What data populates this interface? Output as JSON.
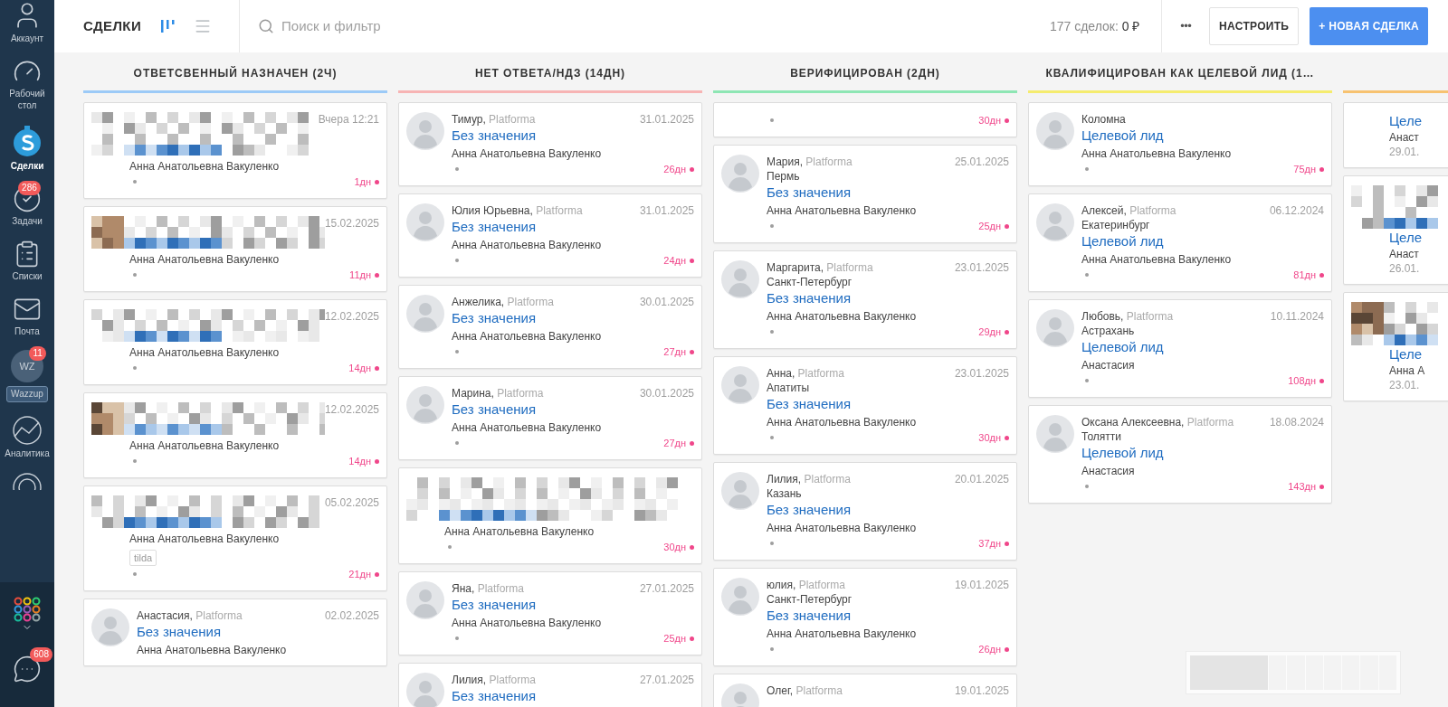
{
  "sidebar": {
    "items": [
      {
        "label": "Аккаунт",
        "selected": false
      },
      {
        "label": "Рабочий стол",
        "selected": false
      },
      {
        "label": "Сделки",
        "selected": true
      },
      {
        "label": "Задачи",
        "selected": false,
        "badge": "286"
      },
      {
        "label": "Списки",
        "selected": false
      },
      {
        "label": "Почта",
        "selected": false
      },
      {
        "label": "Wazzup",
        "selected": false,
        "avatar": "WZ",
        "badge": "11"
      },
      {
        "label": "Аналитика",
        "selected": false
      },
      {
        "selected": false
      }
    ],
    "bottom": [
      {
        "kind": "apps"
      },
      {
        "kind": "chat",
        "badge": "608"
      }
    ]
  },
  "header": {
    "title": "СДЕЛКИ",
    "views": [
      {
        "kind": "pipeline",
        "selected": true
      },
      {
        "kind": "list",
        "selected": false
      }
    ],
    "search": {
      "placeholder": "Поиск и фильтр"
    },
    "count": "177 сделок:",
    "sum": "0 ₽",
    "more": "•••",
    "buttons": [
      {
        "label": "НАСТРОИТЬ",
        "kind": "secondary"
      },
      {
        "label": "+ НОВАЯ СДЕЛКА",
        "kind": "primary"
      }
    ]
  },
  "columns": [
    {
      "title": "ОТВЕТСВЕННЫЙ НАЗНАЧЕН (2Ч)",
      "color": "#9ccaf7",
      "cards": [
        {
          "kind": "blurred",
          "date": "Вчера 12:21",
          "manager": "Анна Анатольевна Вакуленко",
          "days": "1дн"
        },
        {
          "kind": "blurred",
          "date": "15.02.2025",
          "manager": "Анна Анатольевна Вакуленко",
          "days": "11дн"
        },
        {
          "kind": "blurred",
          "date": "12.02.2025",
          "manager": "Анна Анатольевна Вакуленко",
          "days": "14дн"
        },
        {
          "kind": "blurred",
          "date": "12.02.2025",
          "manager": "Анна Анатольевна Вакуленко",
          "days": "14дн"
        },
        {
          "kind": "blurred",
          "date": "05.02.2025",
          "manager": "Анна Анатольевна Вакуленко",
          "tag": "tilda",
          "days": "21дн"
        },
        {
          "kind": "contact",
          "name": "Анастасия,",
          "source": "Platforma",
          "date": "02.02.2025",
          "title": "Без значения",
          "manager": "Анна Анатольевна Вакуленко"
        }
      ]
    },
    {
      "title": "НЕТ ОТВЕТА/НДЗ (14ДН)",
      "color": "#f7b4b4",
      "cards": [
        {
          "kind": "contact",
          "name": "Тимур,",
          "source": "Platforma",
          "date": "31.01.2025",
          "title": "Без значения",
          "manager": "Анна Анатольевна Вакуленко",
          "days": "26дн"
        },
        {
          "kind": "contact",
          "name": "Юлия Юрьевна,",
          "source": "Platforma",
          "date": "31.01.2025",
          "title": "Без значения",
          "manager": "Анна Анатольевна Вакуленко",
          "days": "24дн"
        },
        {
          "kind": "contact",
          "name": "Анжелика,",
          "source": "Platforma",
          "date": "30.01.2025",
          "title": "Без значения",
          "manager": "Анна Анатольевна Вакуленко",
          "days": "27дн"
        },
        {
          "kind": "contact",
          "name": "Марина,",
          "source": "Platforma",
          "date": "30.01.2025",
          "title": "Без значения",
          "manager": "Анна Анатольевна Вакуленко",
          "days": "27дн"
        },
        {
          "kind": "blurred",
          "manager": "Анна Анатольевна Вакуленко",
          "days": "30дн"
        },
        {
          "kind": "contact",
          "name": "Яна,",
          "source": "Platforma",
          "date": "27.01.2025",
          "title": "Без значения",
          "manager": "Анна Анатольевна Вакуленко",
          "days": "25дн"
        },
        {
          "kind": "contact",
          "name": "Лилия,",
          "source": "Platforma",
          "date": "27.01.2025",
          "title": "Без значения"
        }
      ]
    },
    {
      "title": "ВЕРИФИЦИРОВАН (2ДН)",
      "color": "#8ee6b4",
      "cards": [
        {
          "kind": "contact",
          "days": "30дн"
        },
        {
          "kind": "contact",
          "name": "Мария,",
          "source": "Platforma",
          "date": "25.01.2025",
          "city": "Пермь",
          "title": "Без значения",
          "manager": "Анна Анатольевна Вакуленко",
          "days": "25дн"
        },
        {
          "kind": "contact",
          "name": "Маргарита,",
          "source": "Platforma",
          "date": "23.01.2025",
          "city": "Санкт-Петербург",
          "title": "Без значения",
          "manager": "Анна Анатольевна Вакуленко",
          "days": "29дн"
        },
        {
          "kind": "contact",
          "name": "Анна,",
          "source": "Platforma",
          "date": "23.01.2025",
          "city": "Апатиты",
          "title": "Без значения",
          "manager": "Анна Анатольевна Вакуленко",
          "days": "30дн"
        },
        {
          "kind": "contact",
          "name": "Лилия,",
          "source": "Platforma",
          "date": "20.01.2025",
          "city": "Казань",
          "title": "Без значения",
          "manager": "Анна Анатольевна Вакуленко",
          "days": "37дн"
        },
        {
          "kind": "contact",
          "name": "юлия,",
          "source": "Platforma",
          "date": "19.01.2025",
          "city": "Санкт-Петербург",
          "title": "Без значения",
          "manager": "Анна Анатольевна Вакуленко",
          "days": "26дн"
        },
        {
          "kind": "contact",
          "name": "Олег,",
          "source": "Platforma",
          "date": "19.01.2025"
        }
      ]
    },
    {
      "title": "КВАЛИФИЦИРОВАН КАК ЦЕЛЕВОЙ ЛИД (1…",
      "color": "#f5ec6e",
      "cards": [
        {
          "kind": "contact",
          "city": "Коломна",
          "title": "Целевой лид",
          "manager": "Анна Анатольевна Вакуленко",
          "days": "75дн"
        },
        {
          "kind": "contact",
          "name": "Алексей,",
          "source": "Platforma",
          "date": "06.12.2024",
          "city": "Екатеринбург",
          "title": "Целевой лид",
          "manager": "Анна Анатольевна Вакуленко",
          "days": "81дн"
        },
        {
          "kind": "contact",
          "name": "Любовь,",
          "source": "Platforma",
          "date": "10.11.2024",
          "city": "Астрахань",
          "title": "Целевой лид",
          "manager": "Анастасия",
          "days": "108дн"
        },
        {
          "kind": "contact",
          "name": "Оксана Алексеевна,",
          "source": "Platforma",
          "date": "18.08.2024",
          "city": "Толятти",
          "title": "Целевой лид",
          "manager": "Анастасия",
          "days": "143дн"
        }
      ]
    },
    {
      "color": "#f7c270",
      "cards": [
        {
          "kind": "peek",
          "title": "Целе",
          "manager": "Анаст",
          "date": "29.01."
        },
        {
          "kind": "peek",
          "blurred": true,
          "title": "Целе",
          "manager": "Анаст",
          "date": "26.01."
        },
        {
          "kind": "peek",
          "blurred": true,
          "title": "Целе",
          "manager": "Анна А",
          "date": "23.01."
        }
      ]
    }
  ]
}
